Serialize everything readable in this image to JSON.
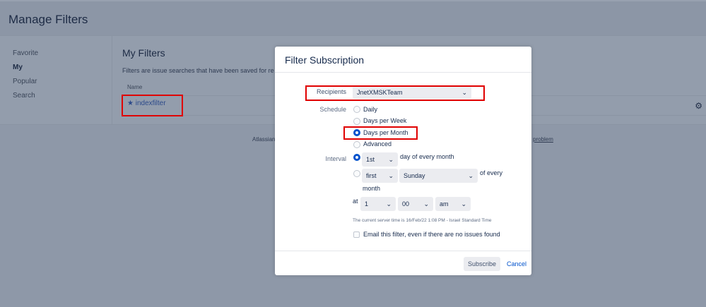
{
  "header": {
    "title": "Manage Filters"
  },
  "sidebar": {
    "items": [
      {
        "label": "Favorite"
      },
      {
        "label": "My"
      },
      {
        "label": "Popular"
      },
      {
        "label": "Search"
      }
    ]
  },
  "main": {
    "title": "My Filters",
    "description": "Filters are issue searches that have been saved for re",
    "column_name": "Name",
    "filters": [
      {
        "name": "indexfilter"
      }
    ]
  },
  "footer": {
    "left": "Atlassian",
    "right": "problem"
  },
  "dialog": {
    "title": "Filter Subscription",
    "recipients_label": "Recipients",
    "recipients_value": "JnetXMSKTeam",
    "schedule_label": "Schedule",
    "schedule_options": [
      {
        "label": "Daily",
        "selected": false
      },
      {
        "label": "Days per Week",
        "selected": false
      },
      {
        "label": "Days per Month",
        "selected": true
      },
      {
        "label": "Advanced",
        "selected": false
      }
    ],
    "interval_label": "Interval",
    "day_value": "1st",
    "day_suffix": "day of every month",
    "week_value": "first",
    "weekday_value": "Sunday",
    "week_suffix": "of every",
    "week_suffix2": "month",
    "at_label": "at",
    "hour": "1",
    "minute": "00",
    "ampm": "am",
    "server_time": "The current server time is 16/Feb/22 1:08 PM - Israel Standard Time",
    "email_label": "Email this filter, even if there are no issues found",
    "subscribe": "Subscribe",
    "cancel": "Cancel"
  }
}
